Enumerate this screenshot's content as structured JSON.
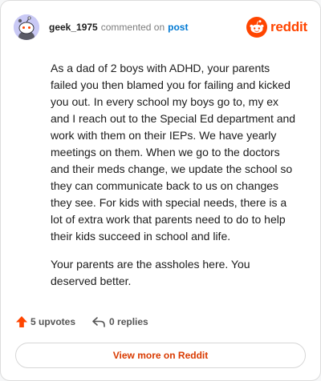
{
  "header": {
    "author": "geek_1975",
    "action": "commented on",
    "post_link": "post"
  },
  "brand": {
    "word": "reddit",
    "color": "#ff4500"
  },
  "comment": {
    "paragraphs": [
      "As a dad of 2 boys with ADHD, your parents failed you then blamed you for failing and kicked you out. In every school my boys go to, my ex and I reach out to the Special Ed department and work with them on their IEPs. We have yearly meetings on them. When we go to the doctors and their meds change, we update the school so they can communicate back to us on changes they see. For kids with special needs, there is a lot of extra work that parents need to do to help their kids succeed in school and life.",
      "Your parents are the assholes here. You deserved better."
    ]
  },
  "footer": {
    "upvotes": "5 upvotes",
    "replies": "0 replies"
  },
  "view_more": "View more on Reddit",
  "icons": {
    "avatar": "snoo-avatar-icon",
    "brand": "reddit-logo-icon",
    "upvote": "upvote-arrow-icon",
    "reply": "reply-icon"
  }
}
